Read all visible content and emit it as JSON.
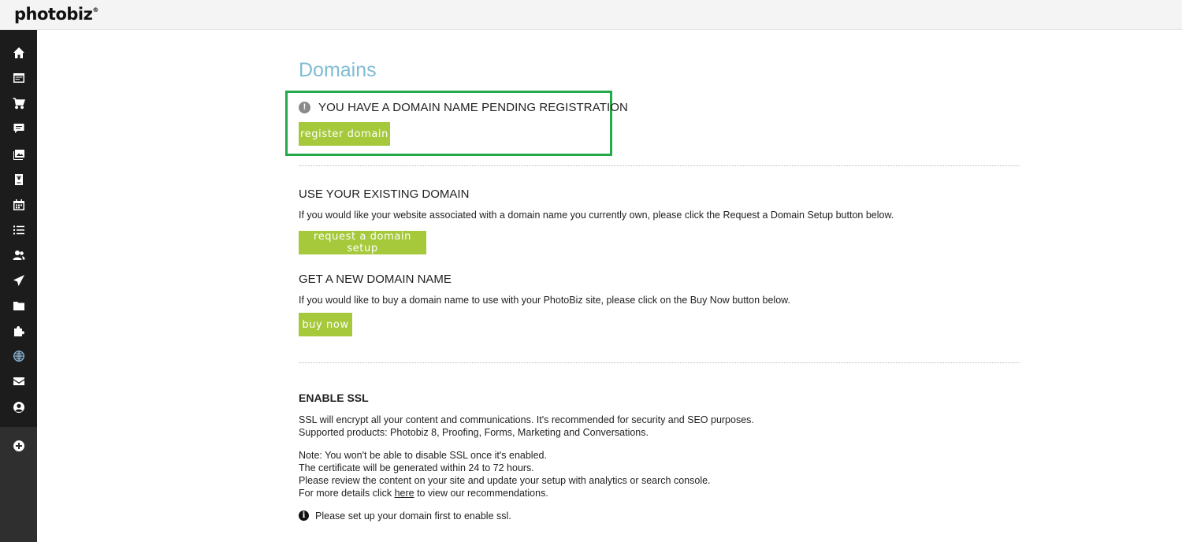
{
  "app": {
    "logo_text": "photobiz",
    "logo_mark": "®"
  },
  "sidebar": {
    "icons": [
      "home-icon",
      "website-icon",
      "cart-icon",
      "chat-icon",
      "gallery-icon",
      "proofing-icon",
      "calendar-icon",
      "list-icon",
      "contacts-icon",
      "send-icon",
      "folder-icon",
      "puzzle-icon",
      "globe-icon",
      "mail-icon",
      "account-icon",
      "add-icon"
    ],
    "active": "globe-icon"
  },
  "page": {
    "title": "Domains"
  },
  "pending": {
    "message": "YOU HAVE A DOMAIN NAME PENDING REGISTRATION",
    "button_label": "register domain"
  },
  "existing": {
    "heading": "USE YOUR EXISTING DOMAIN",
    "text": "If you would like your website associated with a domain name you currently own, please click the Request a Domain Setup button below.",
    "button_label": "request a domain setup"
  },
  "new_domain": {
    "heading": "GET A NEW DOMAIN NAME",
    "text": "If you would like to buy a domain name to use with your PhotoBiz site, please click on the Buy Now button below.",
    "button_label": "buy now"
  },
  "ssl": {
    "heading": "ENABLE SSL",
    "line1": "SSL will encrypt all your content and communications. It's recommended for security and SEO purposes.",
    "line2": "Supported products: Photobiz 8, Proofing, Forms, Marketing and Conversations.",
    "note1": "Note: You won't be able to disable SSL once it's enabled.",
    "note2": "The certificate will be generated within 24 to 72 hours.",
    "note3": "Please review the content on your site and update your setup with analytics or search console.",
    "note4_prefix": "For more details click ",
    "note4_link": "here",
    "note4_suffix": " to view our recommendations.",
    "info": "Please set up your domain first to enable ssl."
  },
  "colors": {
    "accent_green": "#a6c93b",
    "title_blue": "#7fbcd3",
    "highlight_border": "#23a94a",
    "sidebar_bg": "#1c1c1c"
  }
}
